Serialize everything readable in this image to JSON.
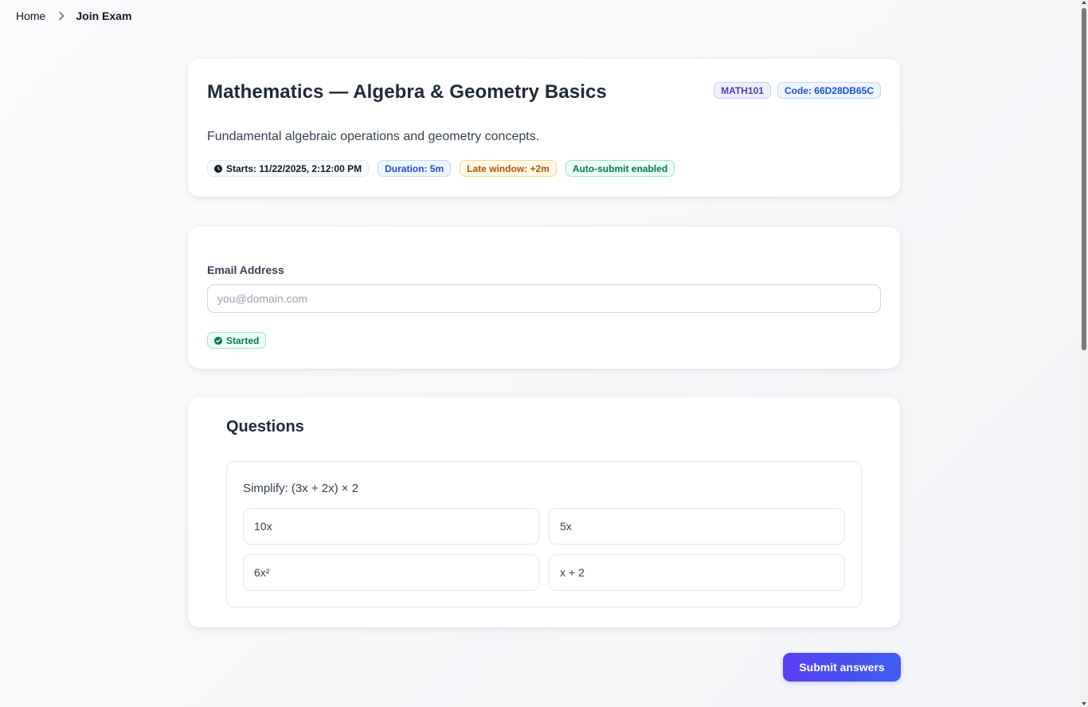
{
  "breadcrumb": {
    "home_label": "Home",
    "current_label": "Join Exam",
    "separator_icon": "chevron-right-icon"
  },
  "exam": {
    "title": "Mathematics — Algebra & Geometry Basics",
    "course_code": "MATH101",
    "exam_code": "Code: 66D28DB65C",
    "description": "Fundamental algebraic operations and geometry concepts.",
    "starts": "Starts: 11/22/2025, 2:12:00 PM",
    "starts_icon": "clock-icon",
    "duration": "Duration: 5m",
    "late_window": "Late window: +2m",
    "auto_submit": "Auto-submit enabled"
  },
  "email": {
    "label": "Email Address",
    "placeholder": "you@domain.com",
    "value": ""
  },
  "status": {
    "label": "Started",
    "icon": "check-circle-icon"
  },
  "questions": {
    "heading": "Questions",
    "items": [
      {
        "text": "Simplify: (3x + 2x) × 2",
        "options": [
          "10x",
          "5x",
          "6x²",
          "x + 2"
        ]
      }
    ]
  },
  "submit": {
    "label": "Submit answers"
  },
  "colors": {
    "accent": "#4f46e5",
    "badge_purple": "#4b3fb5",
    "badge_blue": "#1d4ed8",
    "badge_amber": "#b45309",
    "badge_green": "#047857"
  }
}
